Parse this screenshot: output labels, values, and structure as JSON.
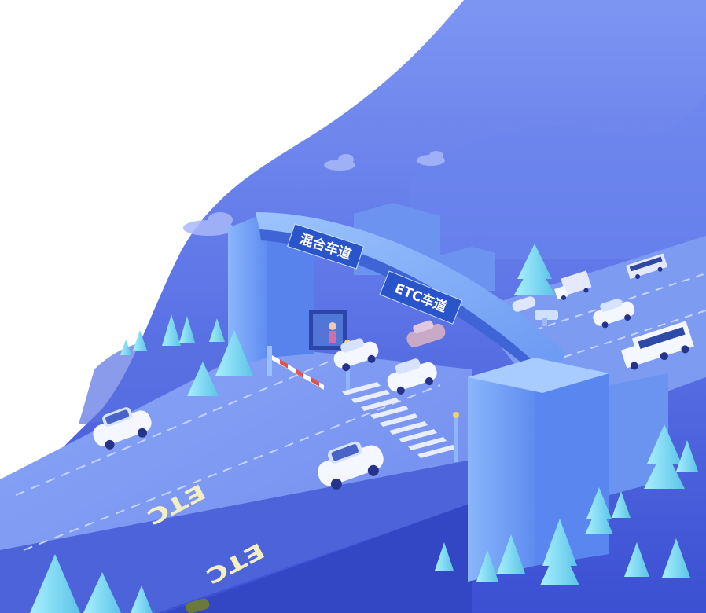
{
  "signs": {
    "mixed_lane": "混合车道",
    "etc_lane": "ETC车道"
  },
  "road_markings": {
    "upper": "ETC",
    "lower": "ETC"
  },
  "colors": {
    "background_top": "#6f8ff0",
    "background_deep": "#3f57d8",
    "road": "#7f9cf3",
    "gantry": "#79a8f7",
    "sign_panel": "#2a54c9",
    "tree": "#6fd7ee",
    "marking": "#f3efc2"
  },
  "icons": [
    "cloud-icon",
    "tree-icon",
    "car-icon",
    "truck-icon",
    "barrier-gate-icon",
    "toll-booth-icon",
    "antenna-icon"
  ]
}
